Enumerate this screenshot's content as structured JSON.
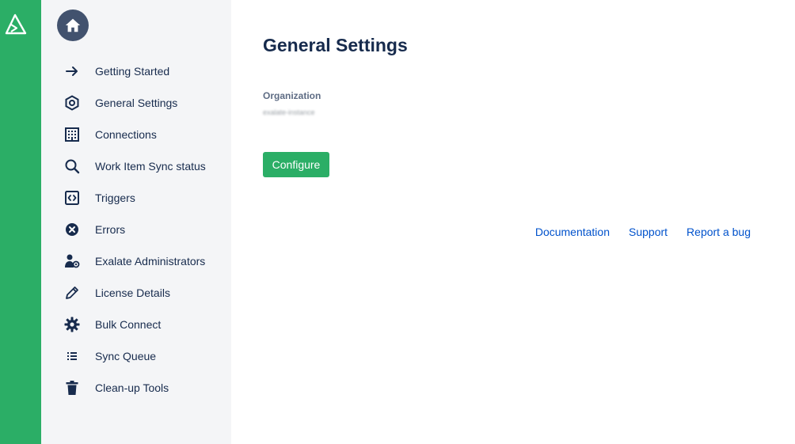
{
  "rail": {
    "logo_icon": "exalate-logo-icon",
    "color": "#2bae66"
  },
  "sidebar": {
    "home_icon": "home-icon",
    "items": [
      {
        "label": "Getting Started",
        "icon": "arrow-right-icon"
      },
      {
        "label": "General Settings",
        "icon": "hexagon-settings-icon"
      },
      {
        "label": "Connections",
        "icon": "building-icon"
      },
      {
        "label": "Work Item Sync status",
        "icon": "search-icon"
      },
      {
        "label": "Triggers",
        "icon": "code-icon"
      },
      {
        "label": "Errors",
        "icon": "error-circle-icon"
      },
      {
        "label": "Exalate Administrators",
        "icon": "admin-user-icon"
      },
      {
        "label": "License Details",
        "icon": "pencil-icon"
      },
      {
        "label": "Bulk Connect",
        "icon": "gear-icon"
      },
      {
        "label": "Sync Queue",
        "icon": "list-icon"
      },
      {
        "label": "Clean-up Tools",
        "icon": "trash-icon"
      }
    ]
  },
  "main": {
    "title": "General Settings",
    "organization_label": "Organization",
    "organization_value": "exalate-instance",
    "configure_label": "Configure"
  },
  "footer": {
    "documentation": "Documentation",
    "support": "Support",
    "report_bug": "Report a bug"
  },
  "colors": {
    "accent": "#2bae66",
    "home_button": "#42526e",
    "link": "#0052cc",
    "sidebar_bg": "#f4f5f7"
  }
}
